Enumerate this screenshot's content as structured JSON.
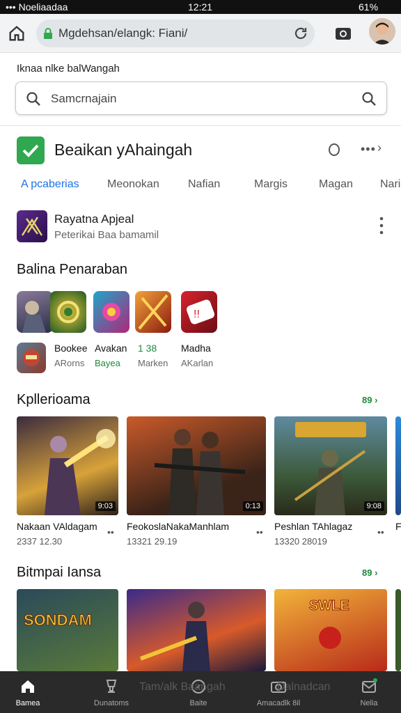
{
  "status_bar": {
    "left": "••• Noeliaadaa",
    "time": "12:21",
    "battery": "61%"
  },
  "browser": {
    "url": "Mgdehsan/elangk: Fiani/"
  },
  "page": {
    "caption": "Iknaa nlke balWangah"
  },
  "search": {
    "placeholder": "Samcrnajain"
  },
  "app": {
    "title": "Beaikan yAhaingah"
  },
  "tabs": [
    {
      "label": "A pcaberias"
    },
    {
      "label": "Meonokan"
    },
    {
      "label": "Nafian"
    },
    {
      "label": "Margis"
    },
    {
      "label": "Magan"
    },
    {
      "label": "Nari"
    }
  ],
  "promo": {
    "title": "Rayatna Apjeal",
    "subtitle": "Peterikai Baa bamamil"
  },
  "section1": {
    "title": "Balina Penaraban"
  },
  "row2": [
    {
      "name": "Bookee",
      "sub": "ARorns"
    },
    {
      "name": "Avakan",
      "sub": "Bayea"
    },
    {
      "name": "1 38",
      "sub": "Marken"
    },
    {
      "name": "Madha",
      "sub": "AKarlan"
    }
  ],
  "section2": {
    "title": "Kpllerioama",
    "more": "89 ›"
  },
  "cards1": [
    {
      "title": "Nakaan VAldagam",
      "sub": "2337 12.30",
      "badge": "9:03"
    },
    {
      "title": "FeokoslaNakaManhlam",
      "sub": "13321 29.19",
      "badge": "0:13"
    },
    {
      "title": "Peshlan TAhlagaz",
      "sub": "13320 28019",
      "badge": "9:08"
    },
    {
      "title": "F",
      "sub": "",
      "badge": ""
    }
  ],
  "section3": {
    "title": "Bitmpai Iansa",
    "more": "89 ›"
  },
  "cards2": [
    {
      "art_text": "SONDAM"
    },
    {
      "art_text": ""
    },
    {
      "art_text": "SWLE"
    }
  ],
  "bottom_nav": [
    {
      "label": "Bamea",
      "icon": "home-icon"
    },
    {
      "label": "Dunatoms",
      "icon": "trophy-icon"
    },
    {
      "label": "Baite",
      "icon": "compass-icon"
    },
    {
      "label": "Amacadlk 8il",
      "icon": "camera-icon"
    },
    {
      "label": "Nelia",
      "icon": "mail-icon"
    }
  ],
  "ghost_text": {
    "left": "Tam/alk Baangah",
    "right": "Dalnadcan"
  }
}
